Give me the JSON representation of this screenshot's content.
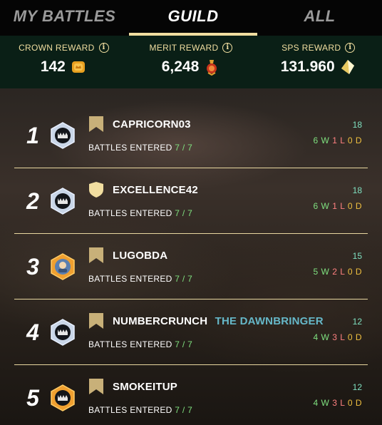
{
  "tabs": [
    {
      "label": "MY BATTLES",
      "active": false
    },
    {
      "label": "GUILD",
      "active": true
    },
    {
      "label": "ALL",
      "active": false
    }
  ],
  "rewards": [
    {
      "label": "CROWN REWARD",
      "value": "142",
      "icon": "crown-token-icon"
    },
    {
      "label": "MERIT REWARD",
      "value": "6,248",
      "icon": "merit-medal-icon"
    },
    {
      "label": "SPS REWARD",
      "value": "131.960",
      "icon": "sps-crystal-icon"
    }
  ],
  "battles_label": "BATTLES ENTERED",
  "players": [
    {
      "rank": "1",
      "name": "CAPRICORN03",
      "title": "",
      "battles": "7 / 7",
      "score": "18",
      "w": "6 W",
      "l": "1 L",
      "d": "0 D",
      "badge": "banner",
      "avatar": "silver"
    },
    {
      "rank": "2",
      "name": "EXCELLENCE42",
      "title": "",
      "battles": "7 / 7",
      "score": "18",
      "w": "6 W",
      "l": "1 L",
      "d": "0 D",
      "badge": "shield",
      "avatar": "silver"
    },
    {
      "rank": "3",
      "name": "LUGOBDA",
      "title": "",
      "battles": "7 / 7",
      "score": "15",
      "w": "5 W",
      "l": "2 L",
      "d": "0 D",
      "badge": "banner",
      "avatar": "gold"
    },
    {
      "rank": "4",
      "name": "NUMBERCRUNCH",
      "title": "THE DAWNBRINGER",
      "battles": "7 / 7",
      "score": "12",
      "w": "4 W",
      "l": "3 L",
      "d": "0 D",
      "badge": "banner",
      "avatar": "silver"
    },
    {
      "rank": "5",
      "name": "SMOKEITUP",
      "title": "",
      "battles": "7 / 7",
      "score": "12",
      "w": "4 W",
      "l": "3 L",
      "d": "0 D",
      "badge": "banner",
      "avatar": "gold"
    }
  ],
  "colors": {
    "accent": "#f1dea0",
    "reward_bar": "#0a1f16",
    "wins": "#7fe07f",
    "losses": "#ff8080",
    "draws": "#f0c040",
    "title": "#66b8c9"
  }
}
